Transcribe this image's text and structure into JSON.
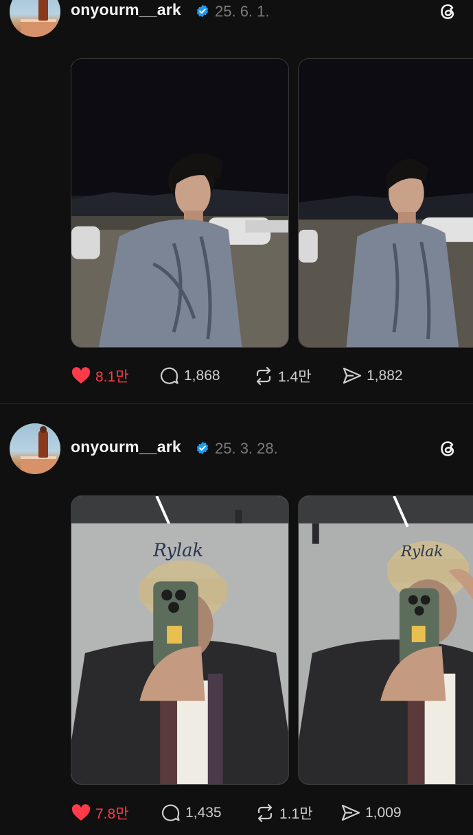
{
  "posts": [
    {
      "username": "onyourm__ark",
      "date": "25. 6. 1.",
      "verified": true,
      "images": [
        {
          "description": "man in grey sweatshirt at night, parking lot, profile view"
        },
        {
          "description": "man in grey sweatshirt at night, facing camera"
        }
      ],
      "actions": {
        "likes": "8.1만",
        "replies": "1,868",
        "reposts": "1.4만",
        "shares": "1,882"
      }
    },
    {
      "username": "onyourm__ark",
      "date": "25. 3. 28.",
      "verified": true,
      "images": [
        {
          "description": "mirror selfie in beige cap and black jacket"
        },
        {
          "description": "mirror selfie in beige cap adjusting brim"
        }
      ],
      "actions": {
        "likes": "7.8만",
        "replies": "1,435",
        "reposts": "1.1만",
        "shares": "1,009"
      }
    }
  ],
  "colors": {
    "background": "#101010",
    "like_active": "#ff3b4a",
    "verified_badge": "#1d9bf0",
    "muted_text": "#7a7a7a"
  },
  "icons": [
    "heart-icon",
    "reply-icon",
    "repost-icon",
    "share-icon",
    "threads-logo-icon",
    "verified-badge-icon"
  ]
}
